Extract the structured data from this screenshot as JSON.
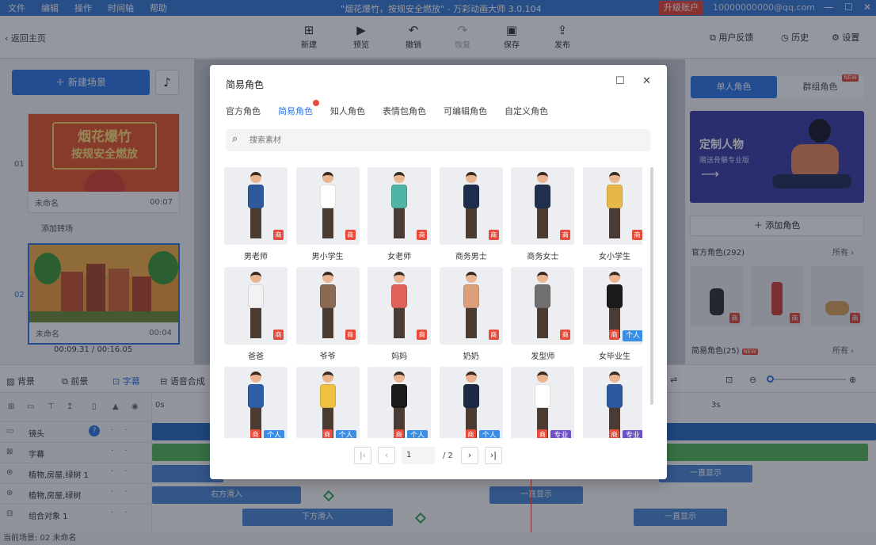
{
  "menubar": {
    "items": [
      "文件",
      "编辑",
      "操作",
      "时间轴",
      "帮助"
    ],
    "title": "\"烟花爆竹，按规安全燃放\" - 万彩动画大师 3.0.104",
    "upgrade": "升级账户",
    "user": "10000000000@qq.com"
  },
  "toolbar": {
    "back": "返回主页",
    "new": "新建",
    "preview": "预览",
    "undo": "撤销",
    "redo": "恢复",
    "save": "保存",
    "publish": "发布",
    "feedback": "用户反馈",
    "history": "历史",
    "settings": "设置"
  },
  "left": {
    "new_scene": "新建场景",
    "scenes": [
      {
        "num": "01",
        "name": "未命名",
        "time": "00:07",
        "thumb_text1": "烟花爆竹",
        "thumb_text2": "按规安全燃放"
      },
      {
        "num": "02",
        "name": "未命名",
        "time": "00:04"
      }
    ],
    "add_transition": "添加转场",
    "timecode": "00:09.31 / 00:16.05"
  },
  "right": {
    "tab_single": "单人角色",
    "tab_group": "群组角色",
    "new_tag": "NEW",
    "banner_title": "定制人物",
    "banner_sub": "赠送骨骼专业版",
    "add_role": "添加角色",
    "official": "官方角色(292)",
    "simple": "简易角色(25)",
    "more": "所有 ›",
    "badge": "商"
  },
  "timeline": {
    "tabs": [
      "背景",
      "前景",
      "字幕",
      "语音合成"
    ],
    "tracks": [
      "镜头",
      "字幕",
      "植物,房屋,绿树 1",
      "植物,房屋,绿树",
      "组合对象 1"
    ],
    "ruler_0": "0s",
    "ruler_3": "3s",
    "segments": {
      "slide_in_right": "右方滑入",
      "always_show": "一直显示",
      "slide_in_bottom": "下方滑入"
    },
    "footer": "当前场景: 02  未命名"
  },
  "modal": {
    "title": "简易角色",
    "tabs": [
      "官方角色",
      "简易角色",
      "知人角色",
      "表情包角色",
      "可编辑角色",
      "自定义角色"
    ],
    "active_tab": 1,
    "search_placeholder": "搜索素材",
    "badge": "商",
    "tag_personal": "个人",
    "tag_pro": "专业",
    "cards": [
      {
        "label": "男老师",
        "color": "#2e5a9c",
        "tag": ""
      },
      {
        "label": "男小学生",
        "color": "#ffffff",
        "tag": ""
      },
      {
        "label": "女老师",
        "color": "#4fb3a6",
        "tag": ""
      },
      {
        "label": "商务男士",
        "color": "#1f2d4d",
        "tag": ""
      },
      {
        "label": "商务女士",
        "color": "#22304f",
        "tag": ""
      },
      {
        "label": "女小学生",
        "color": "#e8b74a",
        "tag": ""
      },
      {
        "label": "爸爸",
        "color": "#f2f2f2",
        "tag": ""
      },
      {
        "label": "爷爷",
        "color": "#8a6a52",
        "tag": ""
      },
      {
        "label": "妈妈",
        "color": "#e0605a",
        "tag": ""
      },
      {
        "label": "奶奶",
        "color": "#d9a07a",
        "tag": ""
      },
      {
        "label": "发型师",
        "color": "#707070",
        "tag": ""
      },
      {
        "label": "女毕业生",
        "color": "#1a1a1a",
        "tag": "personal"
      },
      {
        "label": "",
        "color": "#2e5ea8",
        "tag": "personal"
      },
      {
        "label": "",
        "color": "#f0c040",
        "tag": "personal"
      },
      {
        "label": "",
        "color": "#1a1a1a",
        "tag": "personal"
      },
      {
        "label": "",
        "color": "#1e2a45",
        "tag": "personal"
      },
      {
        "label": "",
        "color": "#ffffff",
        "tag": "pro"
      },
      {
        "label": "",
        "color": "#2c5aa0",
        "tag": "pro"
      }
    ],
    "page_current": "1",
    "page_total": "/ 2"
  }
}
